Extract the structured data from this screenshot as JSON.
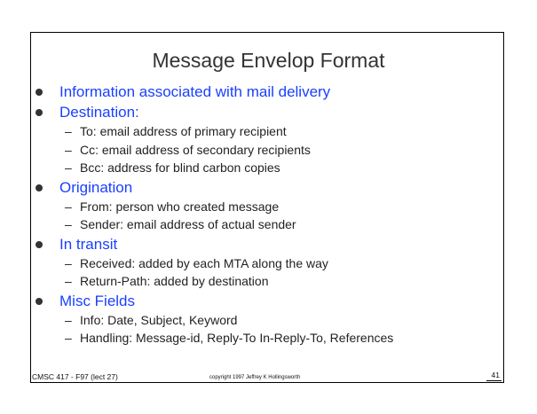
{
  "slide": {
    "title": "Message Envelop Format",
    "bullets": [
      {
        "text": "Information associated with mail delivery",
        "subs": []
      },
      {
        "text": "Destination:",
        "subs": [
          "To: email address of primary recipient",
          "Cc: email address of secondary recipients",
          "Bcc: address for blind carbon copies"
        ]
      },
      {
        "text": "Origination",
        "subs": [
          "From: person who created message",
          "Sender: email address of actual sender"
        ]
      },
      {
        "text": "In transit",
        "subs": [
          "Received: added by each MTA along the way",
          "Return-Path: added by destination"
        ]
      },
      {
        "text": "Misc Fields",
        "subs": [
          "Info: Date, Subject, Keyword",
          "Handling: Message-id, Reply-To In-Reply-To, References"
        ]
      }
    ],
    "sub_marker": "–",
    "footer": {
      "left": "CMSC 417 - F97  (lect 27)",
      "center": "copyright 1997 Jeffrey K Hollingsworth",
      "right": "41"
    }
  },
  "colors": {
    "bullet_text": "#1a3fff",
    "title": "#333333"
  }
}
